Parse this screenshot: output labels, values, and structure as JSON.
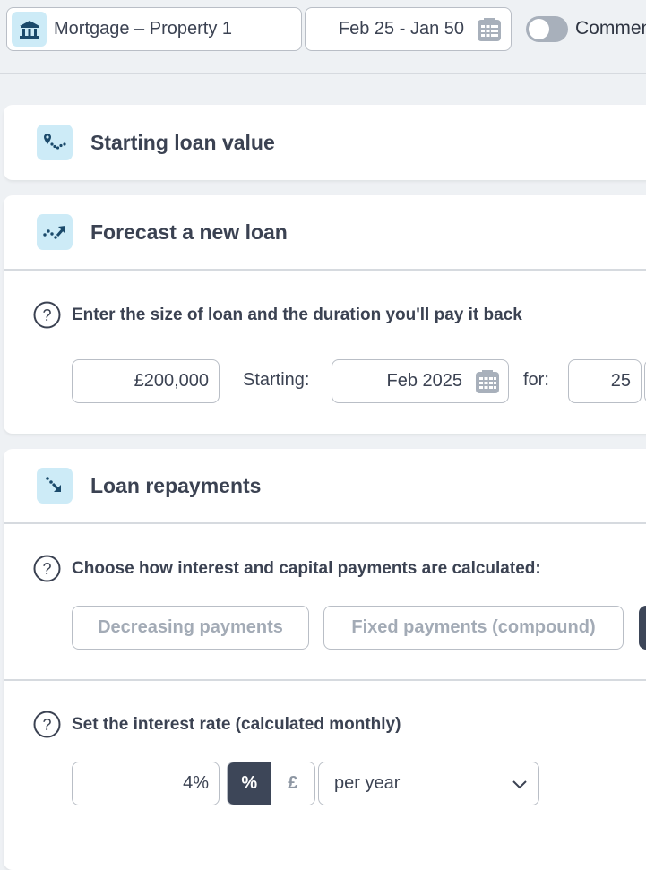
{
  "topbar": {
    "account": {
      "label": "Mortgage – Property 1",
      "icon": "bank-icon"
    },
    "date_range": {
      "value": "Feb 25 - Jan 50",
      "icon": "calendar-icon"
    },
    "toggle": {
      "label": "Comments",
      "visible_label": "Commen",
      "state": "off"
    }
  },
  "sections": {
    "starting_loan": {
      "title": "Starting loan value",
      "icon": "map-pin-trend-icon"
    },
    "forecast": {
      "title": "Forecast a new loan",
      "icon": "trend-up-arrow-icon",
      "question": "Enter the size of loan and the duration you'll pay it back",
      "amount": "£200,000",
      "starting_label": "Starting:",
      "start_date": "Feb 2025",
      "for_label": "for:",
      "duration": "25"
    },
    "repayments": {
      "title": "Loan repayments",
      "icon": "trend-down-arrow-icon",
      "question": "Choose how interest and capital payments are calculated:",
      "options": [
        {
          "label": "Decreasing payments",
          "selected": false
        },
        {
          "label": "Fixed payments (compound)",
          "selected": false
        },
        {
          "label": "",
          "selected": true
        }
      ],
      "interest_question": "Set the interest rate (calculated monthly)",
      "interest_value": "4%",
      "unit_options": [
        {
          "label": "%",
          "selected": true
        },
        {
          "label": "£",
          "selected": false
        }
      ],
      "period": "per year"
    }
  },
  "colors": {
    "accent_dark": "#3d4658",
    "icon_bg": "#cdebf7",
    "icon_fg": "#1b4a6b",
    "muted_text": "#a3abb6",
    "page_bg": "#eef1f4"
  }
}
